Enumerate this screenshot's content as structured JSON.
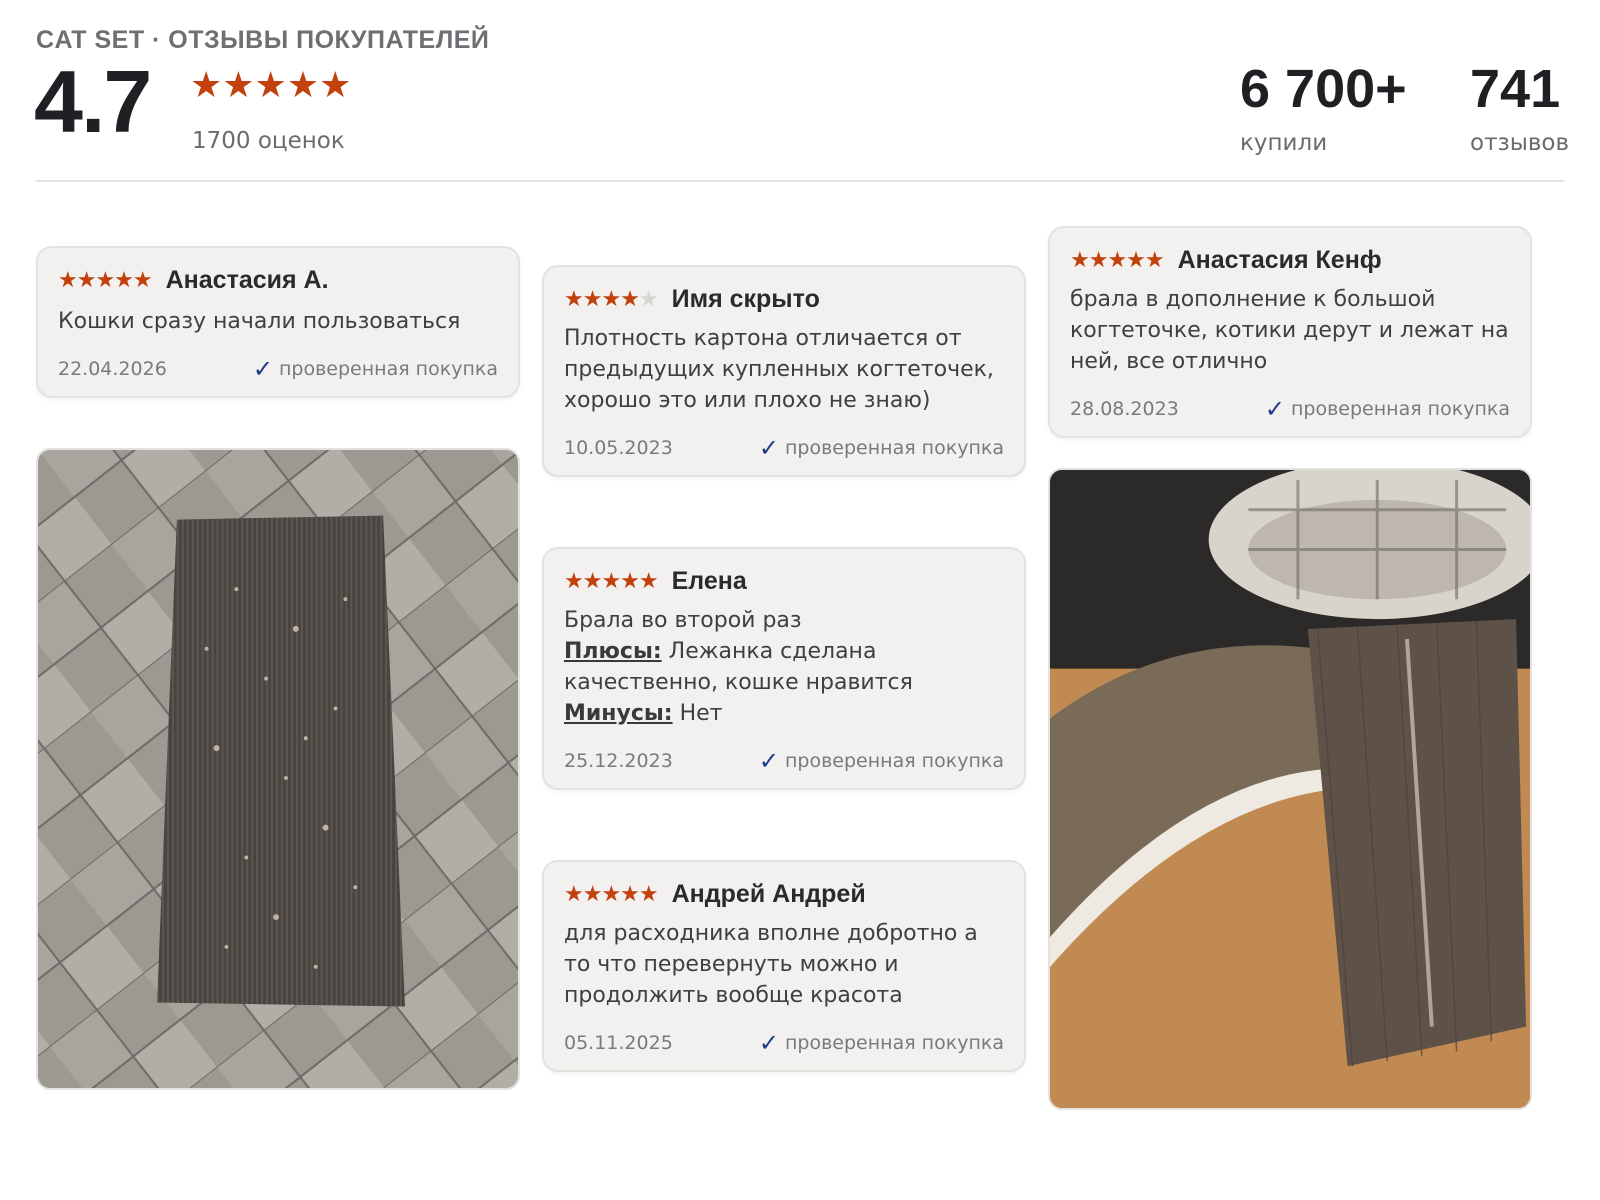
{
  "header": {
    "brand": "CAT SET · ОТЗЫВЫ ПОКУПАТЕЛЕЙ",
    "rating": "4.7",
    "stars_display": "★★★★★",
    "ratings_count": "1700 оценок",
    "bought_value": "6 700+",
    "bought_label": "купили",
    "reviews_value": "741",
    "reviews_label": "отзывов"
  },
  "colors": {
    "star": "#c2410c",
    "check": "#1e3a8a",
    "card_bg": "#f2f1ef"
  },
  "verified_label": "проверенная покупка",
  "reviews": [
    {
      "stars_on": "★★★★★",
      "stars_off": "",
      "author": "Анастасия А.",
      "text": "Кошки сразу начали пользоваться",
      "date": "22.04.2026"
    },
    {
      "stars_on": "★★★★",
      "stars_off": "★",
      "author": "Имя скрыто",
      "text": "Плотность картона отличается от предыдущих купленных когтеточек, хорошо это или плохо не знаю)",
      "date": "10.05.2023"
    },
    {
      "stars_on": "★★★★★",
      "stars_off": "",
      "author": "Анастасия Кенф",
      "text": "брала в дополнение к большой когтеточке, котики дерут и лежат на ней, все отлично",
      "date": "28.08.2023"
    },
    {
      "stars_on": "★★★★★",
      "stars_off": "",
      "author": "Елена",
      "text": "Брала во второй раз",
      "pros_label": "Плюсы:",
      "pros_text": " Лежанка сделана качественно, кошке нравится",
      "cons_label": "Минусы:",
      "cons_text": " Нет",
      "date": "25.12.2023"
    },
    {
      "stars_on": "★★★★★",
      "stars_off": "",
      "author": "Андрей Андрей",
      "text": "для расходника вполне добротно а то что перевернуть можно и продолжить вообще красота",
      "date": "05.11.2025"
    }
  ]
}
